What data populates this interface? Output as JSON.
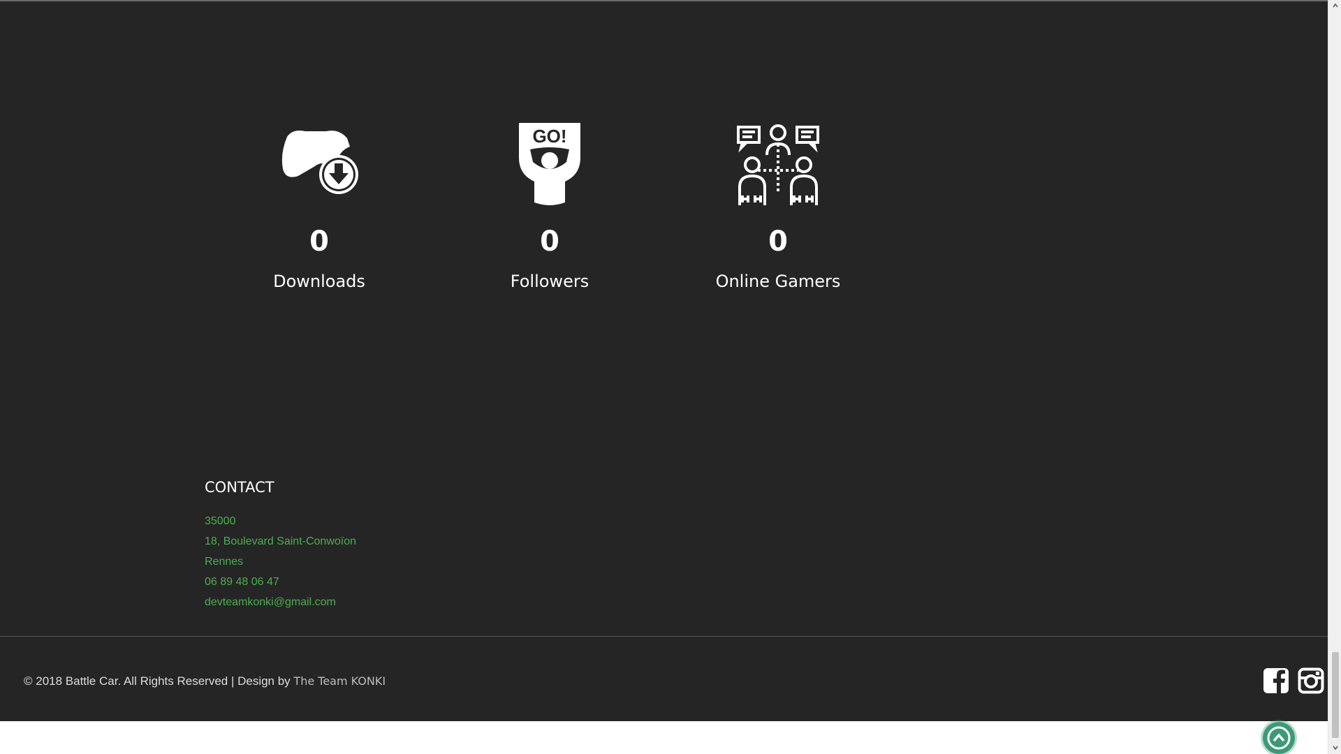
{
  "stats": [
    {
      "icon": "gamepad-download-icon",
      "value": "0",
      "label": "Downloads"
    },
    {
      "icon": "go-sign-fan-icon",
      "value": "0",
      "label": "Followers"
    },
    {
      "icon": "gamers-network-icon",
      "value": "0",
      "label": "Online Gamers"
    }
  ],
  "contact": {
    "title": "CONTACT",
    "postal_code": "35000",
    "street": "18, Boulevard Saint-Conwoïon",
    "city": "Rennes",
    "phone": "06 89 48 06 47",
    "email": "devteamkonki@gmail.com"
  },
  "footer": {
    "copyright": "© 2018 Battle Car. All Rights Reserved | Design by",
    "designer": "The Team KONKI",
    "social": [
      "facebook-icon",
      "instagram-icon"
    ]
  },
  "go_sign_text": "GO!",
  "colors": {
    "background": "#252525",
    "accent_green": "#4caf50",
    "scroll_top": "#3c9a79",
    "text": "#ffffff"
  }
}
